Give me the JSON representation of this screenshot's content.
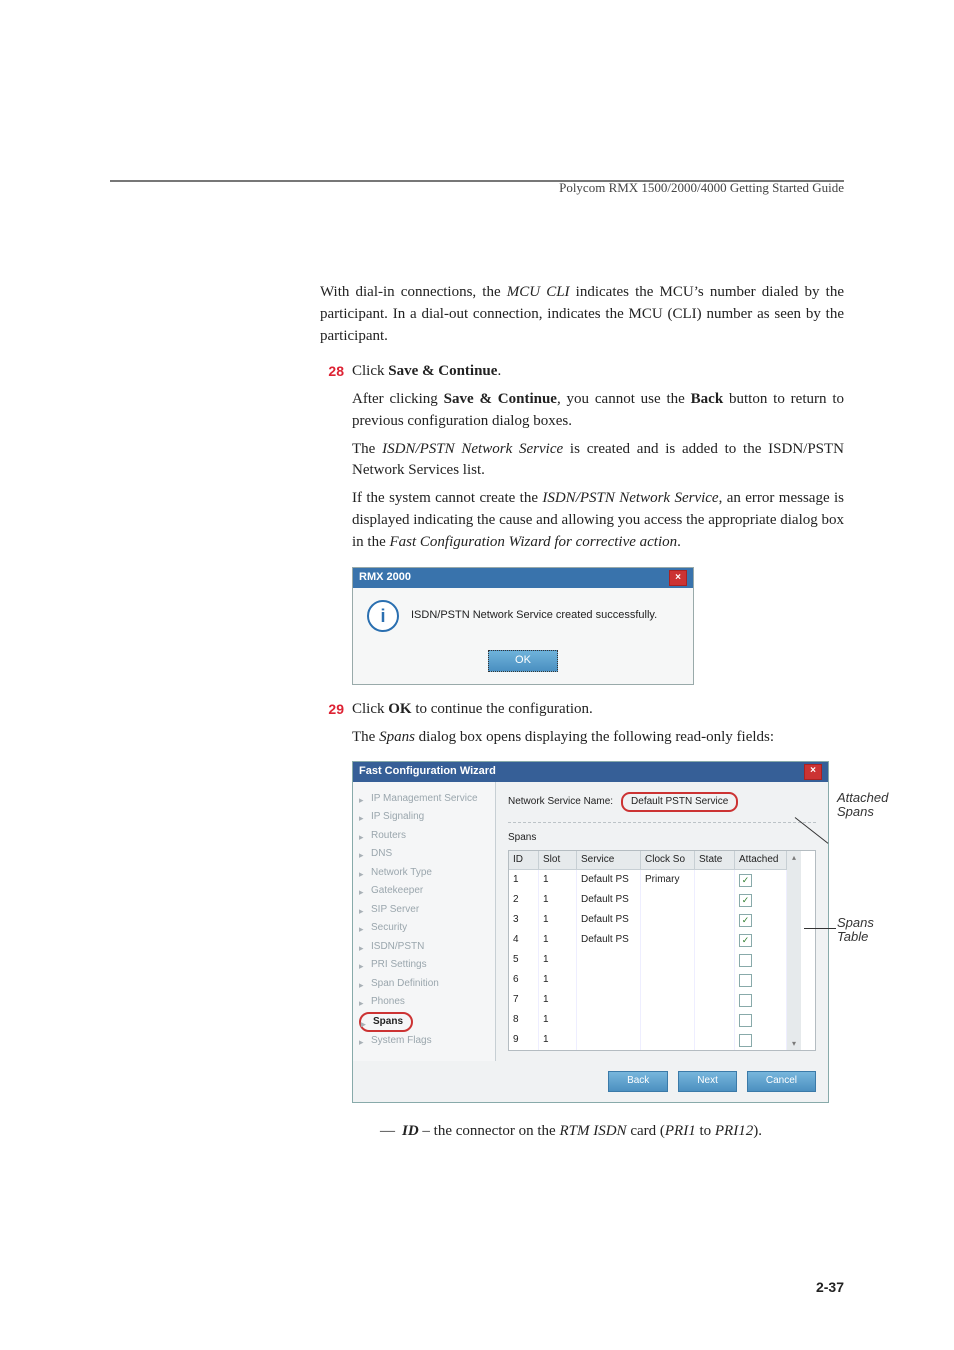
{
  "running_head": "Polycom RMX 1500/2000/4000 Getting Started Guide",
  "intro": {
    "p1a": "With dial-in connections, the ",
    "p1b": "MCU CLI",
    "p1c": " indicates the MCU’s number dialed by the participant. In a dial-out connection, indicates the MCU (CLI) number as seen by the participant."
  },
  "steps": {
    "n28": "28",
    "s28_a1": "Click ",
    "s28_a2": "Save & Continue",
    "s28_a3": ".",
    "s28_b1": "After clicking ",
    "s28_b2": "Save & Continue",
    "s28_b3": ", you cannot use the ",
    "s28_b4": "Back",
    "s28_b5": " button to return to previous configuration dialog boxes.",
    "s28_c1": "The ",
    "s28_c2": "ISDN/PSTN Network Service",
    "s28_c3": " is created and is added to the ISDN/PSTN Network Services list.",
    "s28_d1": "If the system cannot create the ",
    "s28_d2": "ISDN/PSTN Network Service",
    "s28_d3": ", an error message is displayed indicating the cause and allowing you access the appropriate dialog box in the ",
    "s28_d4": "Fast Configuration Wizard for corrective action",
    "s28_d5": ".",
    "n29": "29",
    "s29_a1": "Click ",
    "s29_a2": "OK",
    "s29_a3": " to continue the configuration.",
    "s29_b1": "The ",
    "s29_b2": "Spans",
    "s29_b3": " dialog box opens displaying the following read-only fields:"
  },
  "dlg1": {
    "title": "RMX 2000",
    "msg": "ISDN/PSTN Network Service created successfully.",
    "ok": "OK"
  },
  "wiz": {
    "title": "Fast Configuration Wizard",
    "svc_label": "Network Service Name:",
    "svc_name": "Default PSTN Service",
    "spans_label": "Spans",
    "side": {
      "items": [
        "IP Management Service",
        "IP Signaling",
        "Routers",
        "DNS",
        "Network Type",
        "Gatekeeper",
        "SIP Server",
        "Security",
        "ISDN/PSTN",
        "PRI Settings",
        "Span Definition",
        "Phones",
        "Spans",
        "System Flags"
      ]
    },
    "cols": {
      "id": "ID",
      "slot": "Slot",
      "service": "Service",
      "clock": "Clock So",
      "state": "State",
      "attached": "Attached"
    },
    "rows": [
      {
        "id": "1",
        "slot": "1",
        "service": "Default PS",
        "clock": "Primary",
        "state": "",
        "att": true
      },
      {
        "id": "2",
        "slot": "1",
        "service": "Default PS",
        "clock": "",
        "state": "",
        "att": true
      },
      {
        "id": "3",
        "slot": "1",
        "service": "Default PS",
        "clock": "",
        "state": "",
        "att": true
      },
      {
        "id": "4",
        "slot": "1",
        "service": "Default PS",
        "clock": "",
        "state": "",
        "att": true
      },
      {
        "id": "5",
        "slot": "1",
        "service": "",
        "clock": "",
        "state": "",
        "att": false
      },
      {
        "id": "6",
        "slot": "1",
        "service": "",
        "clock": "",
        "state": "",
        "att": false
      },
      {
        "id": "7",
        "slot": "1",
        "service": "",
        "clock": "",
        "state": "",
        "att": false
      },
      {
        "id": "8",
        "slot": "1",
        "service": "",
        "clock": "",
        "state": "",
        "att": false
      },
      {
        "id": "9",
        "slot": "1",
        "service": "",
        "clock": "",
        "state": "",
        "att": false
      }
    ],
    "buttons": {
      "back": "Back",
      "next": "Next",
      "cancel": "Cancel"
    }
  },
  "annotations": {
    "attached_spans": "Attached Spans",
    "spans_table": "Spans Table"
  },
  "bullet": {
    "dash": "—",
    "b1a": "ID",
    "b1b": " – the connector on the ",
    "b1c": "RTM ISDN",
    "b1d": " card (",
    "b1e": "PRI1",
    "b1f": " to ",
    "b1g": "PRI12",
    "b1h": ")."
  },
  "page_number": "2-37"
}
